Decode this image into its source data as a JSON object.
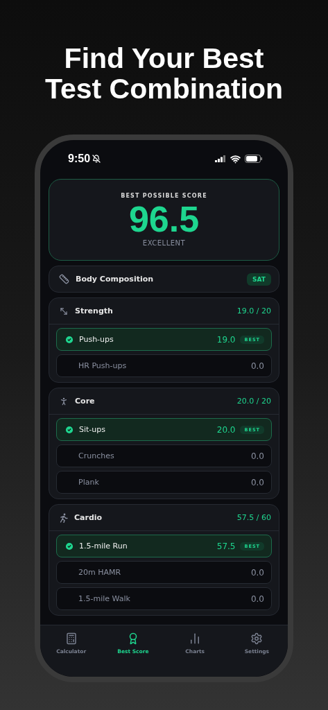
{
  "headline": [
    "Find Your Best",
    "Test Combination"
  ],
  "status_bar": {
    "time": "9:50"
  },
  "score_card": {
    "label": "BEST POSSIBLE SCORE",
    "score": "96.5",
    "rating": "EXCELLENT"
  },
  "sections": [
    {
      "kind": "badge",
      "title": "Body Composition",
      "badge": "SAT"
    },
    {
      "kind": "group",
      "title": "Strength",
      "total": "19.0 / 20",
      "items": [
        {
          "name": "Push-ups",
          "score": "19.0",
          "selected": true,
          "tag": "BEST"
        },
        {
          "name": "HR Push-ups",
          "score": "0.0",
          "selected": false
        }
      ]
    },
    {
      "kind": "group",
      "title": "Core",
      "total": "20.0 / 20",
      "items": [
        {
          "name": "Sit-ups",
          "score": "20.0",
          "selected": true,
          "tag": "BEST"
        },
        {
          "name": "Crunches",
          "score": "0.0",
          "selected": false
        },
        {
          "name": "Plank",
          "score": "0.0",
          "selected": false
        }
      ]
    },
    {
      "kind": "group",
      "title": "Cardio",
      "total": "57.5 / 60",
      "items": [
        {
          "name": "1.5-mile Run",
          "score": "57.5",
          "selected": true,
          "tag": "BEST"
        },
        {
          "name": "20m HAMR",
          "score": "0.0",
          "selected": false
        },
        {
          "name": "1.5-mile Walk",
          "score": "0.0",
          "selected": false
        }
      ]
    }
  ],
  "tabs": [
    {
      "label": "Calculator",
      "selected": false
    },
    {
      "label": "Best Score",
      "selected": true
    },
    {
      "label": "Charts",
      "selected": false
    },
    {
      "label": "Settings",
      "selected": false
    }
  ]
}
